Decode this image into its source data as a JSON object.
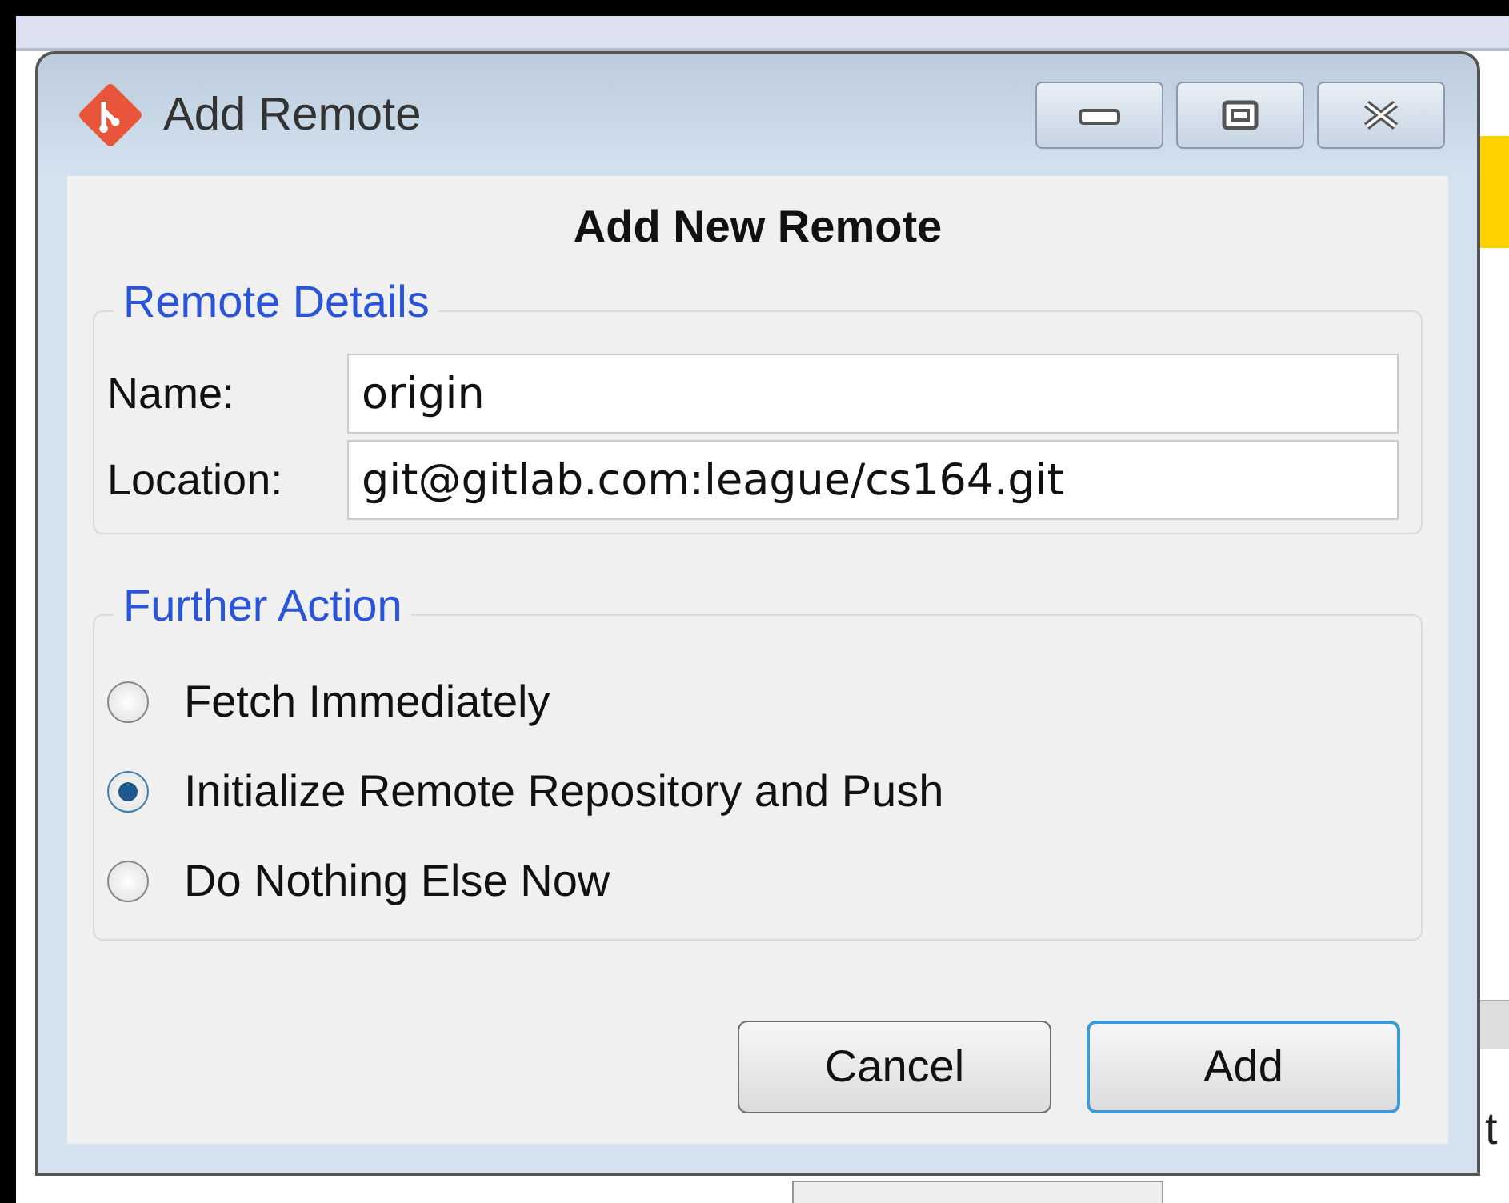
{
  "window": {
    "title": "Add Remote"
  },
  "heading": "Add New Remote",
  "remote_details": {
    "legend": "Remote Details",
    "fields": [
      {
        "label": "Name:",
        "value": "origin"
      },
      {
        "label": "Location:",
        "value": "git@gitlab.com:league/cs164.git"
      }
    ]
  },
  "further_action": {
    "legend": "Further Action",
    "options": [
      {
        "label": "Fetch Immediately",
        "selected": false
      },
      {
        "label": "Initialize Remote Repository and Push",
        "selected": true
      },
      {
        "label": "Do Nothing Else Now",
        "selected": false
      }
    ]
  },
  "buttons": [
    {
      "label": "Cancel",
      "default": false
    },
    {
      "label": "Add",
      "default": true
    }
  ],
  "background": {
    "text_fragment": "t"
  }
}
